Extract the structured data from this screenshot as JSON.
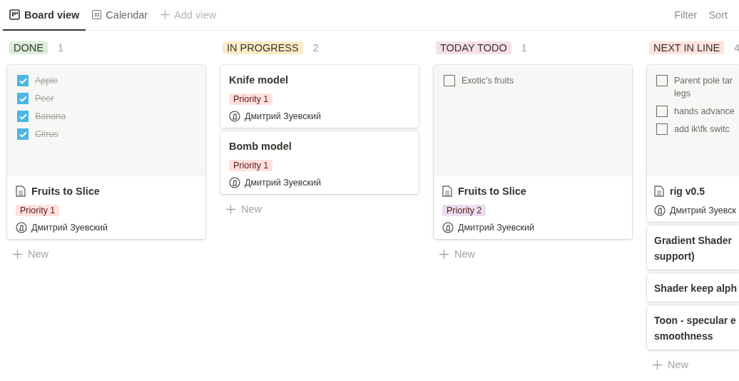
{
  "views": [
    {
      "label": "Board view",
      "selected": true
    },
    {
      "label": "Calendar",
      "selected": false
    }
  ],
  "add_view": "Add view",
  "calendar_day": "31",
  "actions": [
    "Filter",
    "Sort"
  ],
  "columns": [
    {
      "name": "DONE",
      "color": "#dbeddb",
      "count": "1",
      "new_label": "New",
      "cards": [
        {
          "checklist": [
            {
              "text": "Apple",
              "checked": true
            },
            {
              "text": "Peer",
              "checked": true
            },
            {
              "text": "Banana",
              "checked": true
            },
            {
              "text": "Citrus",
              "checked": true
            }
          ],
          "page_icon": true,
          "title": "Fruits to Slice",
          "tag": {
            "label": "Priority 1",
            "color": "#ffe2dd"
          },
          "person": "Дмитрий Зуевский"
        }
      ]
    },
    {
      "name": "IN PROGRESS",
      "color": "#fdecc8",
      "count": "2",
      "new_label": "New",
      "cards": [
        {
          "page_icon": false,
          "title": "Knife model",
          "tag": {
            "label": "Priority 1",
            "color": "#ffe2dd"
          },
          "person": "Дмитрий Зуевский"
        },
        {
          "page_icon": false,
          "title": "Bomb model",
          "tag": {
            "label": "Priority 1",
            "color": "#ffe2dd"
          },
          "person": "Дмитрий Зуевский"
        }
      ]
    },
    {
      "name": "TODAY TODO",
      "color": "#f5e0e9",
      "count": "1",
      "new_label": "New",
      "cards": [
        {
          "checklist": [
            {
              "text": "Exotic's fruits",
              "checked": false
            }
          ],
          "page_icon": true,
          "title": "Fruits to Slice",
          "tag": {
            "label": "Priority 2",
            "color": "#e8deee"
          },
          "person": "Дмитрий Зуевский"
        }
      ]
    },
    {
      "name": "NEXT IN LINE",
      "color": "#ffe2dd",
      "count": "4",
      "new_label": "New",
      "cards": [
        {
          "checklist": [
            {
              "text": "Parent pole tar\nlegs",
              "checked": false
            },
            {
              "text": "hands advance",
              "checked": false
            },
            {
              "text": "add ik\\fk switc",
              "checked": false
            }
          ],
          "page_icon": true,
          "title": "rig v0.5",
          "person": "Дмитрий Зуевск"
        },
        {
          "page_icon": false,
          "title": "Gradient Shader\nsupport)"
        },
        {
          "page_icon": false,
          "title": "Shader keep alph"
        },
        {
          "page_icon": false,
          "title": "Toon - specular e\nsmoothness"
        }
      ]
    }
  ]
}
